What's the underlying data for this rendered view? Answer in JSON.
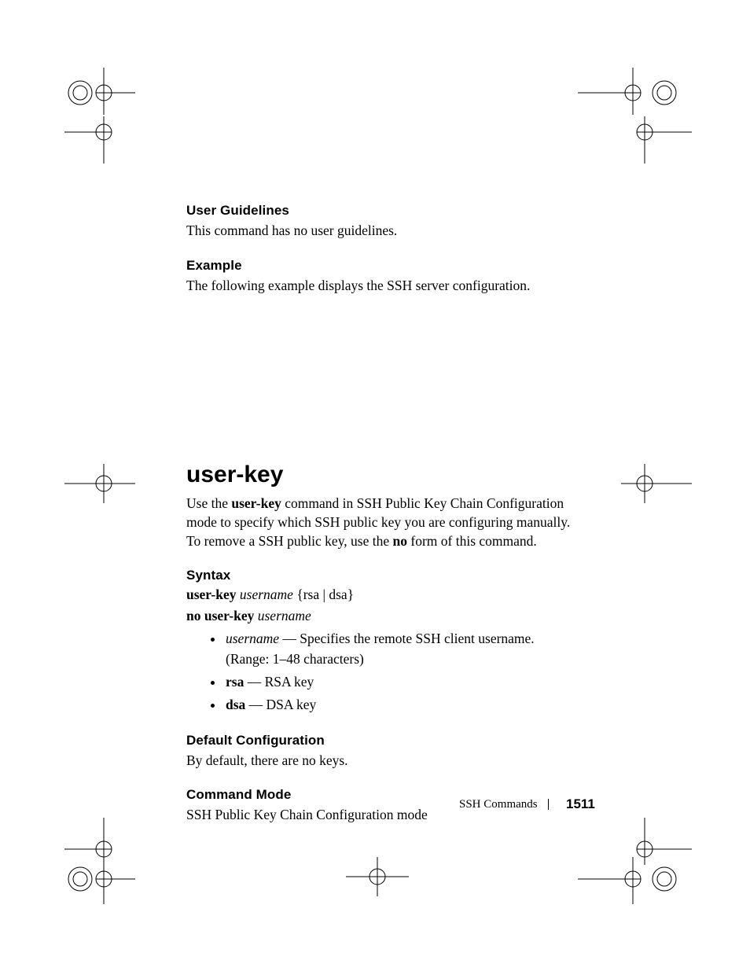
{
  "sections": {
    "user_guidelines": {
      "heading": "User Guidelines",
      "body": "This command has no user guidelines."
    },
    "example": {
      "heading": "Example",
      "body": "The following example displays the SSH server configuration."
    }
  },
  "command": {
    "title": "user-key",
    "description_parts": {
      "p1": "Use the ",
      "kw1": "user-key",
      "p2": " command in SSH Public Key Chain Configuration mode to specify which SSH public key you are configuring manually. To remove a SSH public key, use the ",
      "kw2": "no",
      "p3": " form of this command."
    },
    "syntax": {
      "heading": "Syntax",
      "line1": {
        "kw": "user-key",
        "var": "username",
        "rest": " {rsa | dsa}"
      },
      "line2": {
        "kw": "no user-key",
        "var": "username"
      },
      "params": [
        {
          "var": "username",
          "sep": " — ",
          "desc": "Specifies the remote SSH client username. (Range: 1–48 characters)"
        },
        {
          "kw": "rsa",
          "sep": " — ",
          "desc": "RSA key"
        },
        {
          "kw": "dsa",
          "sep": " — ",
          "desc": "DSA key"
        }
      ]
    },
    "default_config": {
      "heading": "Default Configuration",
      "body": "By default, there are no keys."
    },
    "command_mode": {
      "heading": "Command Mode",
      "body": "SSH Public Key Chain Configuration mode"
    }
  },
  "footer": {
    "section": "SSH Commands",
    "page": "1511"
  }
}
